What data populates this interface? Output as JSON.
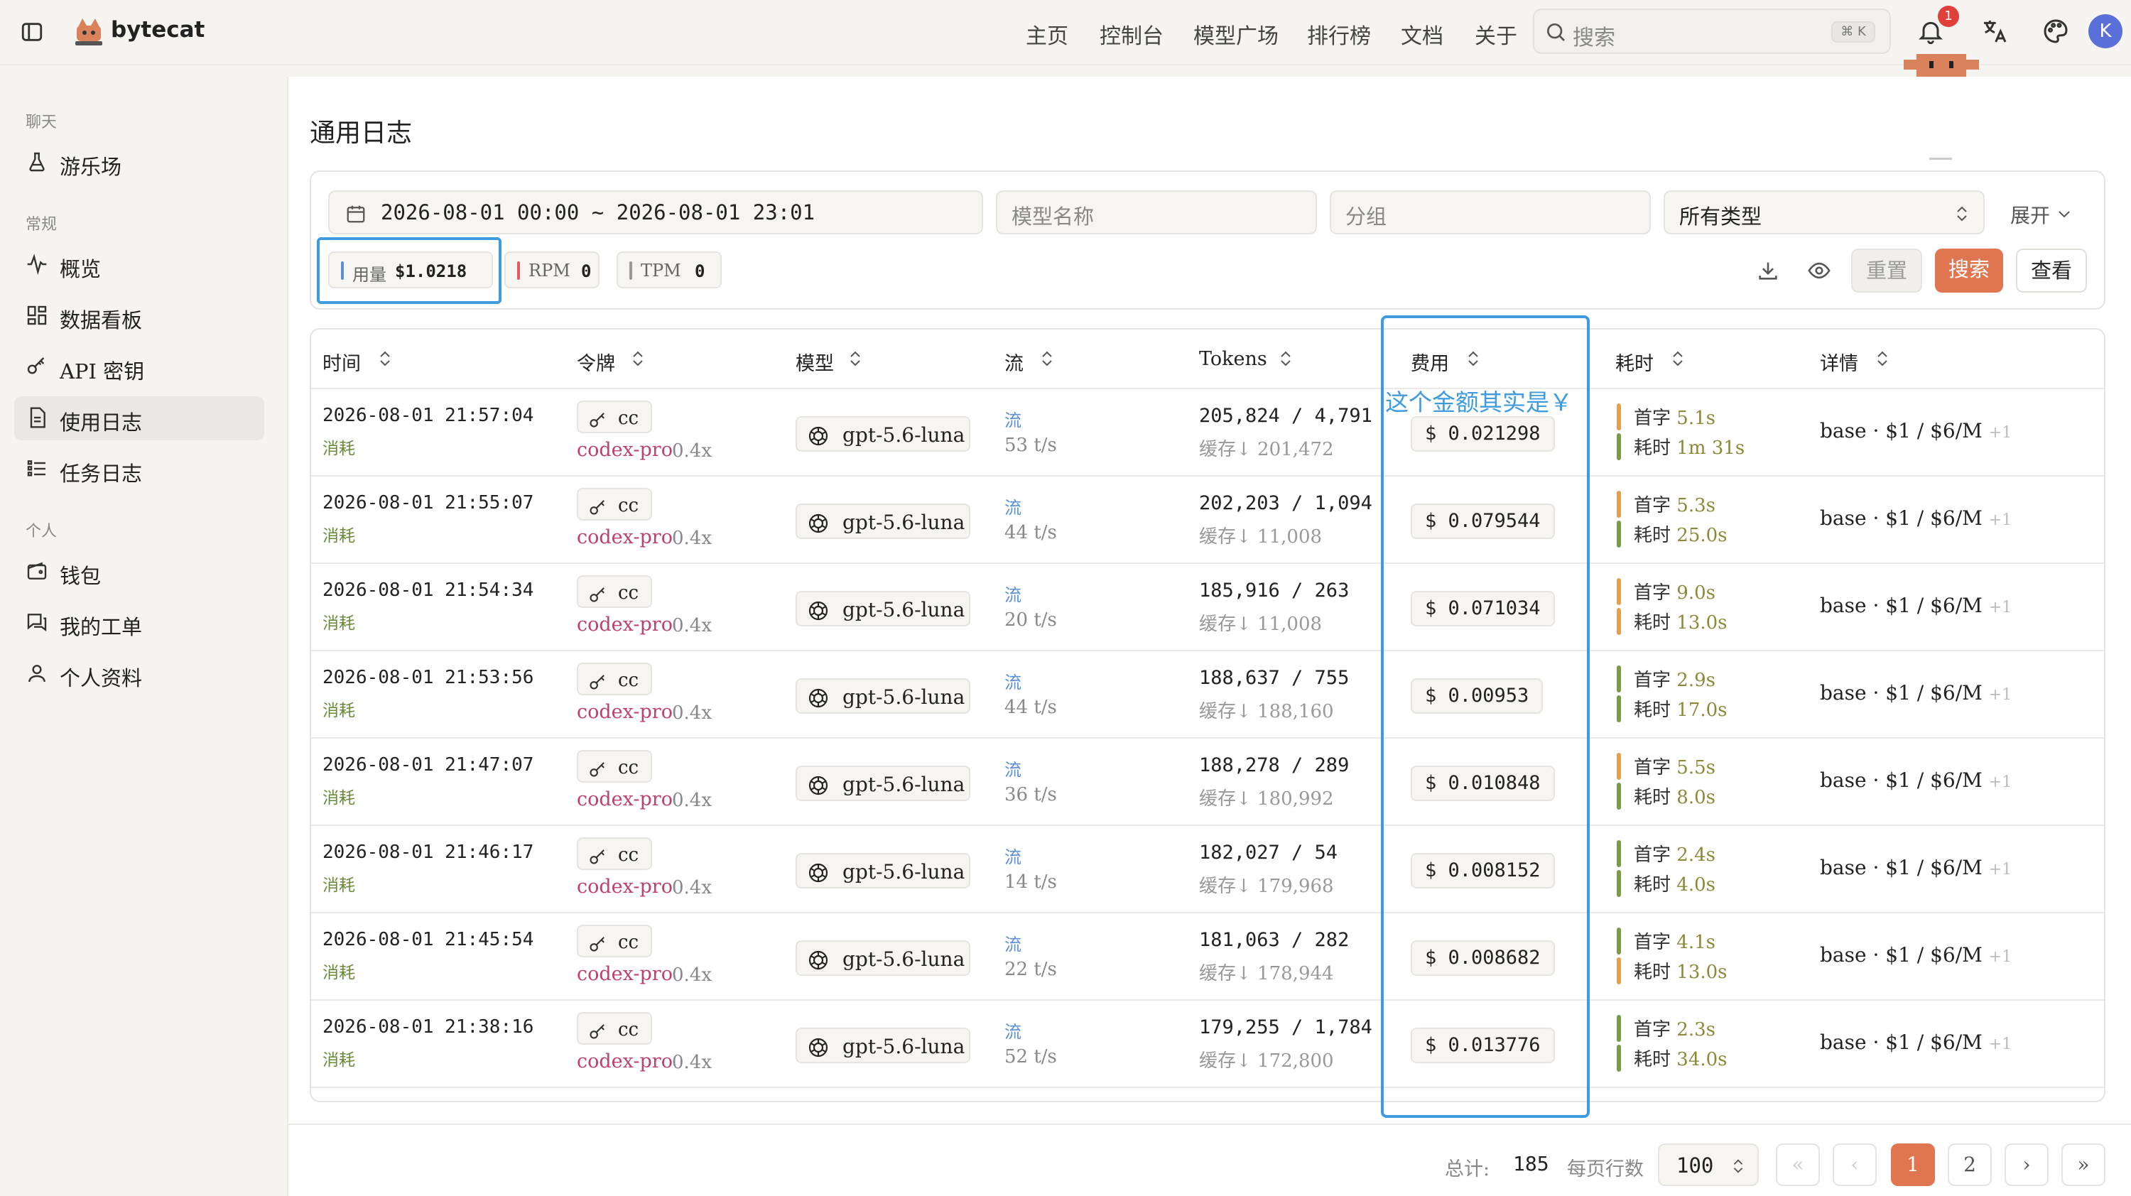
{
  "header": {
    "brand": "bytecat",
    "nav": [
      "主页",
      "控制台",
      "模型广场",
      "排行榜",
      "文档",
      "关于"
    ],
    "search_placeholder": "搜索",
    "search_shortcut": "⌘ K",
    "notification_count": "1",
    "avatar_letter": "K"
  },
  "sidebar": {
    "sections": [
      {
        "title": "聊天",
        "items": [
          {
            "label": "游乐场",
            "icon": "flask-icon"
          }
        ]
      },
      {
        "title": "常规",
        "items": [
          {
            "label": "概览",
            "icon": "pulse-icon"
          },
          {
            "label": "数据看板",
            "icon": "dashboard-icon"
          },
          {
            "label": "API 密钥",
            "icon": "key-icon"
          },
          {
            "label": "使用日志",
            "icon": "document-icon",
            "active": true
          },
          {
            "label": "任务日志",
            "icon": "list-icon"
          }
        ]
      },
      {
        "title": "个人",
        "items": [
          {
            "label": "钱包",
            "icon": "wallet-icon"
          },
          {
            "label": "我的工单",
            "icon": "ticket-icon"
          },
          {
            "label": "个人资料",
            "icon": "user-icon"
          }
        ]
      }
    ]
  },
  "page": {
    "title": "通用日志"
  },
  "filters": {
    "date_range": "2026-08-01 00:00 ~ 2026-08-01 23:01",
    "model_placeholder": "模型名称",
    "group_placeholder": "分组",
    "type_select": "所有类型",
    "expand_label": "展开"
  },
  "stats": {
    "usage_label": "用量",
    "usage_value": "$1.0218",
    "rpm_label": "RPM",
    "rpm_value": "0",
    "tpm_label": "TPM",
    "tpm_value": "0"
  },
  "actions": {
    "reset": "重置",
    "search": "搜索",
    "view": "查看"
  },
  "table": {
    "columns": [
      "时间",
      "令牌",
      "模型",
      "流",
      "Tokens",
      "费用",
      "耗时",
      "详情"
    ],
    "rows": [
      {
        "time": "2026-08-01 21:57:04",
        "kind": "消耗",
        "token": "cc",
        "group": "codex-pro",
        "ratio": "0.4x",
        "model": "gpt-5.6-luna",
        "stream": "流",
        "speed": "53 t/s",
        "tokens": "205,824 / 4,791",
        "cache": "缓存↓ 201,472",
        "cost": "$ 0.021298",
        "first": "5.1s",
        "total": "1m 31s",
        "first_color": "#e0a050",
        "total_color": "#7a9a4a",
        "detail": "base · $1 / $6/M",
        "detail_extra": "+1"
      },
      {
        "time": "2026-08-01 21:55:07",
        "kind": "消耗",
        "token": "cc",
        "group": "codex-pro",
        "ratio": "0.4x",
        "model": "gpt-5.6-luna",
        "stream": "流",
        "speed": "44 t/s",
        "tokens": "202,203 / 1,094",
        "cache": "缓存↓ 11,008",
        "cost": "$ 0.079544",
        "first": "5.3s",
        "total": "25.0s",
        "first_color": "#e0a050",
        "total_color": "#7a9a4a",
        "detail": "base · $1 / $6/M",
        "detail_extra": "+1"
      },
      {
        "time": "2026-08-01 21:54:34",
        "kind": "消耗",
        "token": "cc",
        "group": "codex-pro",
        "ratio": "0.4x",
        "model": "gpt-5.6-luna",
        "stream": "流",
        "speed": "20 t/s",
        "tokens": "185,916 / 263",
        "cache": "缓存↓ 11,008",
        "cost": "$ 0.071034",
        "first": "9.0s",
        "total": "13.0s",
        "first_color": "#e0a050",
        "total_color": "#e0a050",
        "detail": "base · $1 / $6/M",
        "detail_extra": "+1"
      },
      {
        "time": "2026-08-01 21:53:56",
        "kind": "消耗",
        "token": "cc",
        "group": "codex-pro",
        "ratio": "0.4x",
        "model": "gpt-5.6-luna",
        "stream": "流",
        "speed": "44 t/s",
        "tokens": "188,637 / 755",
        "cache": "缓存↓ 188,160",
        "cost": "$ 0.00953",
        "first": "2.9s",
        "total": "17.0s",
        "first_color": "#7a9a4a",
        "total_color": "#7a9a4a",
        "detail": "base · $1 / $6/M",
        "detail_extra": "+1"
      },
      {
        "time": "2026-08-01 21:47:07",
        "kind": "消耗",
        "token": "cc",
        "group": "codex-pro",
        "ratio": "0.4x",
        "model": "gpt-5.6-luna",
        "stream": "流",
        "speed": "36 t/s",
        "tokens": "188,278 / 289",
        "cache": "缓存↓ 180,992",
        "cost": "$ 0.010848",
        "first": "5.5s",
        "total": "8.0s",
        "first_color": "#e0a050",
        "total_color": "#7a9a4a",
        "detail": "base · $1 / $6/M",
        "detail_extra": "+1"
      },
      {
        "time": "2026-08-01 21:46:17",
        "kind": "消耗",
        "token": "cc",
        "group": "codex-pro",
        "ratio": "0.4x",
        "model": "gpt-5.6-luna",
        "stream": "流",
        "speed": "14 t/s",
        "tokens": "182,027 / 54",
        "cache": "缓存↓ 179,968",
        "cost": "$ 0.008152",
        "first": "2.4s",
        "total": "4.0s",
        "first_color": "#7a9a4a",
        "total_color": "#7a9a4a",
        "detail": "base · $1 / $6/M",
        "detail_extra": "+1"
      },
      {
        "time": "2026-08-01 21:45:54",
        "kind": "消耗",
        "token": "cc",
        "group": "codex-pro",
        "ratio": "0.4x",
        "model": "gpt-5.6-luna",
        "stream": "流",
        "speed": "22 t/s",
        "tokens": "181,063 / 282",
        "cache": "缓存↓ 178,944",
        "cost": "$ 0.008682",
        "first": "4.1s",
        "total": "13.0s",
        "first_color": "#7a9a4a",
        "total_color": "#e0a050",
        "detail": "base · $1 / $6/M",
        "detail_extra": "+1"
      },
      {
        "time": "2026-08-01 21:38:16",
        "kind": "消耗",
        "token": "cc",
        "group": "codex-pro",
        "ratio": "0.4x",
        "model": "gpt-5.6-luna",
        "stream": "流",
        "speed": "52 t/s",
        "tokens": "179,255 / 1,784",
        "cache": "缓存↓ 172,800",
        "cost": "$ 0.013776",
        "first": "2.3s",
        "total": "34.0s",
        "first_color": "#7a9a4a",
        "total_color": "#7a9a4a",
        "detail": "base · $1 / $6/M",
        "detail_extra": "+1"
      }
    ],
    "first_label": "首字",
    "total_label": "耗时"
  },
  "annotation": "这个金额其实是￥",
  "pagination": {
    "total_label": "总计:",
    "total": "185",
    "rows_per_page_label": "每页行数",
    "rows_per_page": "100",
    "pages": [
      "1",
      "2"
    ],
    "current_page": "1"
  },
  "colors": {
    "accent": "#e07650",
    "annotation": "#3f9be0",
    "group_text": "#c0406a",
    "kind_text": "#6a8a3a",
    "stream_text": "#5b8fd8"
  }
}
